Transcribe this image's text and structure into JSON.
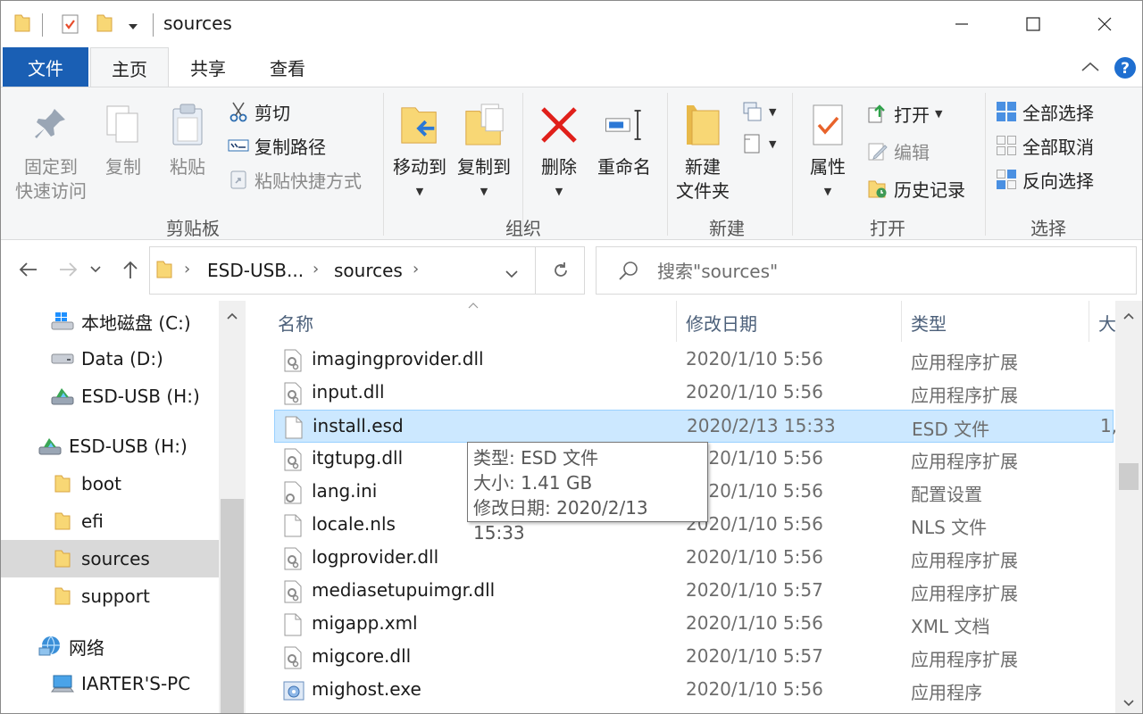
{
  "window": {
    "title": "sources"
  },
  "ribbon_tabs": {
    "file": "文件",
    "home": "主页",
    "share": "共享",
    "view": "查看"
  },
  "clipboard": {
    "pin_line1": "固定到",
    "pin_line2": "快速访问",
    "copy": "复制",
    "paste": "粘贴",
    "cut": "剪切",
    "copy_path": "复制路径",
    "paste_shortcut": "粘贴快捷方式",
    "label": "剪贴板"
  },
  "organize": {
    "move_to": "移动到",
    "copy_to": "复制到",
    "delete": "删除",
    "rename": "重命名",
    "label": "组织"
  },
  "new": {
    "new_folder_line1": "新建",
    "new_folder_line2": "文件夹",
    "label": "新建"
  },
  "open": {
    "properties": "属性",
    "open": "打开",
    "edit": "编辑",
    "history": "历史记录",
    "label": "打开"
  },
  "select": {
    "select_all": "全部选择",
    "select_none": "全部取消",
    "invert": "反向选择",
    "label": "选择"
  },
  "address": {
    "crumbs": [
      "ESD-USB...",
      "sources"
    ]
  },
  "search": {
    "placeholder": "搜索\"sources\""
  },
  "nav_pane": [
    {
      "label": "本地磁盘 (C:)",
      "icon": "windows-drive-icon"
    },
    {
      "label": "Data (D:)",
      "icon": "drive-icon"
    },
    {
      "label": "ESD-USB (H:)",
      "icon": "usb-drive-icon"
    },
    {
      "label": "ESD-USB (H:)",
      "icon": "usb-drive-icon"
    },
    {
      "label": "boot",
      "icon": "folder-icon"
    },
    {
      "label": "efi",
      "icon": "folder-icon"
    },
    {
      "label": "sources",
      "icon": "folder-icon",
      "selected": true
    },
    {
      "label": "support",
      "icon": "folder-icon"
    },
    {
      "label": "网络",
      "icon": "network-icon"
    },
    {
      "label": "IARTER'S-PC",
      "icon": "computer-icon"
    }
  ],
  "columns": {
    "name": "名称",
    "date": "修改日期",
    "type": "类型",
    "size": "大"
  },
  "files": [
    {
      "name": "imagingprovider.dll",
      "date": "2020/1/10 5:56",
      "type": "应用程序扩展",
      "size": ""
    },
    {
      "name": "input.dll",
      "date": "2020/1/10 5:56",
      "type": "应用程序扩展",
      "size": ""
    },
    {
      "name": "install.esd",
      "date": "2020/2/13 15:33",
      "type": "ESD 文件",
      "size": "1,",
      "selected": true
    },
    {
      "name": "itgtupg.dll",
      "date": "2020/1/10 5:56",
      "type": "应用程序扩展",
      "size": ""
    },
    {
      "name": "lang.ini",
      "date": "2020/1/10 5:56",
      "type": "配置设置",
      "size": ""
    },
    {
      "name": "locale.nls",
      "date": "2020/1/10 5:56",
      "type": "NLS 文件",
      "size": ""
    },
    {
      "name": "logprovider.dll",
      "date": "2020/1/10 5:56",
      "type": "应用程序扩展",
      "size": ""
    },
    {
      "name": "mediasetupuimgr.dll",
      "date": "2020/1/10 5:57",
      "type": "应用程序扩展",
      "size": ""
    },
    {
      "name": "migapp.xml",
      "date": "2020/1/10 5:56",
      "type": "XML 文档",
      "size": ""
    },
    {
      "name": "migcore.dll",
      "date": "2020/1/10 5:57",
      "type": "应用程序扩展",
      "size": ""
    },
    {
      "name": "mighost.exe",
      "date": "2020/1/10 5:56",
      "type": "应用程序",
      "size": ""
    }
  ],
  "tooltip": {
    "type": "类型: ESD 文件",
    "size": "大小: 1.41 GB",
    "modified": "修改日期: 2020/2/13 15:33"
  },
  "colors": {
    "accent": "#1a5fb4",
    "selection": "#cce8ff",
    "folder": "#f8d775"
  }
}
